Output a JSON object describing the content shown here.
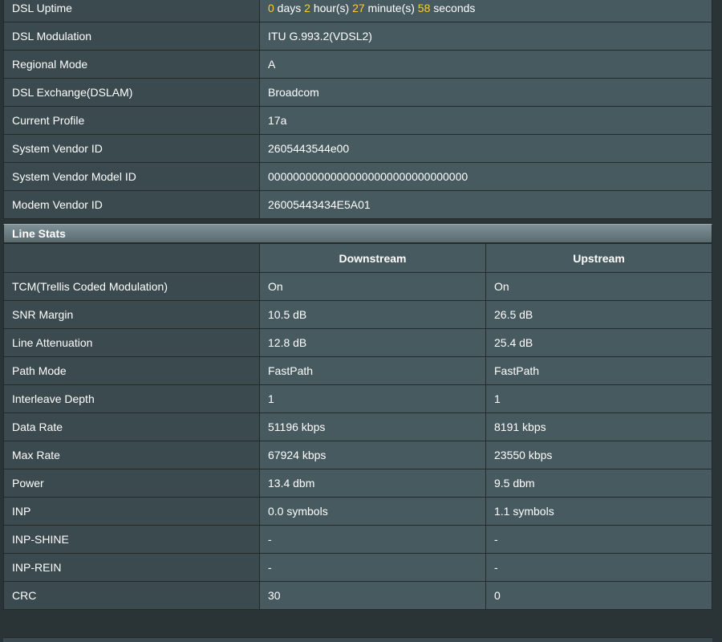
{
  "info_rows": [
    {
      "label": "DSL Uptime",
      "value": ""
    },
    {
      "label": "DSL Modulation",
      "value": "ITU G.993.2(VDSL2)"
    },
    {
      "label": "Regional Mode",
      "value": "A"
    },
    {
      "label": "DSL Exchange(DSLAM)",
      "value": "Broadcom"
    },
    {
      "label": "Current Profile",
      "value": "17a"
    },
    {
      "label": "System Vendor ID",
      "value": "2605443544e00"
    },
    {
      "label": "System Vendor Model ID",
      "value": "00000000000000000000000000000000"
    },
    {
      "label": "Modem Vendor ID",
      "value": "26005443434E5A01"
    }
  ],
  "uptime": {
    "days": "0",
    "days_unit": " days ",
    "hours": "2",
    "hours_unit": " hour(s) ",
    "minutes": "27",
    "minutes_unit": " minute(s) ",
    "seconds": "58",
    "seconds_unit": " seconds"
  },
  "line_stats": {
    "title": "Line Stats",
    "col_downstream": "Downstream",
    "col_upstream": "Upstream",
    "rows": [
      {
        "label": "TCM(Trellis Coded Modulation)",
        "down": "On",
        "up": "On"
      },
      {
        "label": "SNR Margin",
        "down": "10.5 dB",
        "up": "26.5 dB"
      },
      {
        "label": "Line Attenuation",
        "down": "12.8 dB",
        "up": "25.4 dB"
      },
      {
        "label": "Path Mode",
        "down": "FastPath",
        "up": "FastPath"
      },
      {
        "label": "Interleave Depth",
        "down": "1",
        "up": "1"
      },
      {
        "label": "Data Rate",
        "down": "51196 kbps",
        "up": "8191 kbps"
      },
      {
        "label": "Max Rate",
        "down": "67924 kbps",
        "up": "23550 kbps"
      },
      {
        "label": "Power",
        "down": "13.4 dbm",
        "up": "9.5 dbm"
      },
      {
        "label": "INP",
        "down": "0.0 symbols",
        "up": "1.1 symbols"
      },
      {
        "label": "INP-SHINE",
        "down": "-",
        "up": "-"
      },
      {
        "label": "INP-REIN",
        "down": "-",
        "up": "-"
      },
      {
        "label": "CRC",
        "down": "30",
        "up": "0"
      }
    ]
  },
  "colors": {
    "highlight": "#ffcc33",
    "label_bg": "#3b4a4f",
    "value_bg": "#475a5f"
  }
}
